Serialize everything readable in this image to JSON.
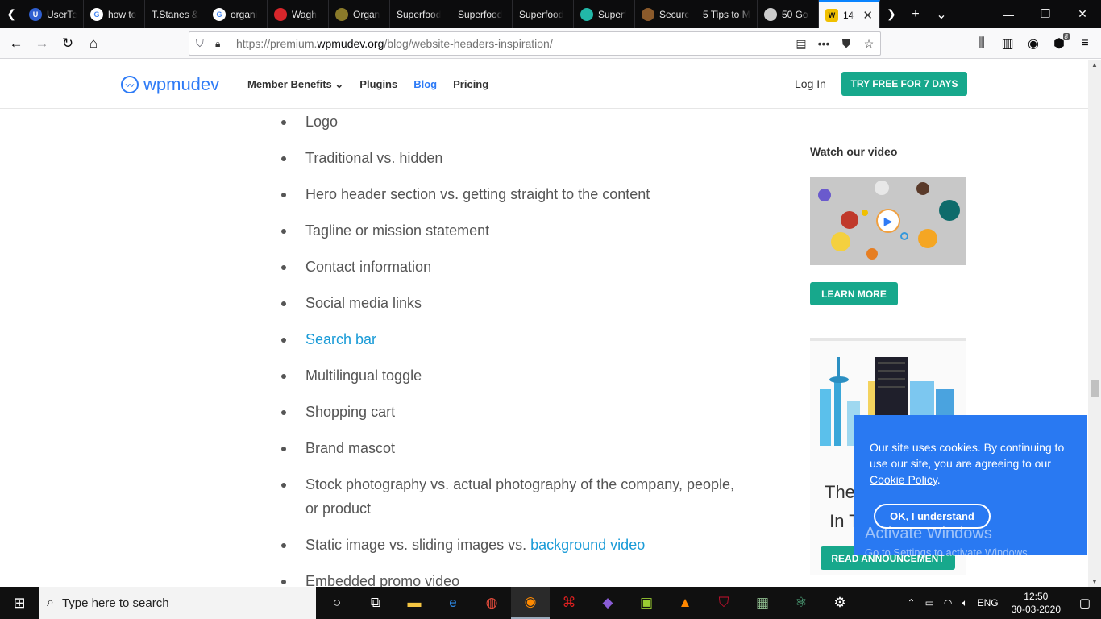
{
  "browser": {
    "tabs": [
      {
        "title": "UserTe",
        "favicon_color": "#2f5fd0",
        "favicon_glyph": "U"
      },
      {
        "title": "how to",
        "favicon_color": "#ffffff",
        "favicon_glyph": "G"
      },
      {
        "title": "T.Stanes &",
        "favicon_color": "",
        "favicon_glyph": ""
      },
      {
        "title": "organi",
        "favicon_color": "#ffffff",
        "favicon_glyph": "G"
      },
      {
        "title": "Wagh",
        "favicon_color": "#d8262b",
        "favicon_glyph": ""
      },
      {
        "title": "Organ",
        "favicon_color": "#8a7a2a",
        "favicon_glyph": ""
      },
      {
        "title": "Superfood",
        "favicon_color": "",
        "favicon_glyph": ""
      },
      {
        "title": "Superfood",
        "favicon_color": "",
        "favicon_glyph": ""
      },
      {
        "title": "Superfood",
        "favicon_color": "",
        "favicon_glyph": ""
      },
      {
        "title": "Superf",
        "favicon_color": "#22b8a8",
        "favicon_glyph": ""
      },
      {
        "title": "Secure",
        "favicon_color": "#8b5a2b",
        "favicon_glyph": ""
      },
      {
        "title": "5 Tips to M",
        "favicon_color": "",
        "favicon_glyph": ""
      },
      {
        "title": "50 Go",
        "favicon_color": "#cccccc",
        "favicon_glyph": ""
      },
      {
        "title": "14",
        "favicon_color": "#f0c000",
        "favicon_glyph": "W"
      }
    ],
    "url_host_prefix": "https://premium.",
    "url_host": "wpmudev.org",
    "url_path": "/blog/website-headers-inspiration/",
    "extension_badge": "8"
  },
  "site": {
    "logo_text": "wpmudev",
    "menu": {
      "member_benefits": "Member Benefits",
      "plugins": "Plugins",
      "blog": "Blog",
      "pricing": "Pricing"
    },
    "login": "Log In",
    "try_free": "TRY FREE FOR 7 DAYS",
    "accent_color": "#17a88c",
    "brand_color": "#2e7bf6"
  },
  "article": {
    "items": [
      {
        "text": "Logo"
      },
      {
        "text": "Traditional vs. hidden"
      },
      {
        "text": "Hero header section vs. getting straight to the content"
      },
      {
        "text": "Tagline or mission statement"
      },
      {
        "text": "Contact information"
      },
      {
        "text": "Social media links"
      },
      {
        "text": "Search bar",
        "link": true
      },
      {
        "text": "Multilingual toggle"
      },
      {
        "text": "Shopping cart"
      },
      {
        "text": "Brand mascot"
      },
      {
        "text": "Stock photography vs. actual photography of the company, people, or product"
      },
      {
        "text": "Static image vs. sliding images vs. ",
        "link_text": "background video"
      },
      {
        "text": "Embedded promo video"
      }
    ]
  },
  "sidebar": {
    "video_title": "Watch our video",
    "learn_more": "LEARN MORE",
    "ad_text_line1": "The",
    "ad_text_line2": "In T",
    "read_announcement": "READ ANNOUNCEMENT"
  },
  "cookie": {
    "text": "Our site uses cookies. By continuing to use our site, you are agreeing to our",
    "policy_link": "Cookie Policy",
    "ok": "OK, I understand"
  },
  "watermark": {
    "title": "Activate Windows",
    "subtitle": "Go to Settings to activate Windows."
  },
  "taskbar": {
    "search_placeholder": "Type here to search",
    "lang": "ENG",
    "time": "12:50",
    "date": "30-03-2020"
  }
}
